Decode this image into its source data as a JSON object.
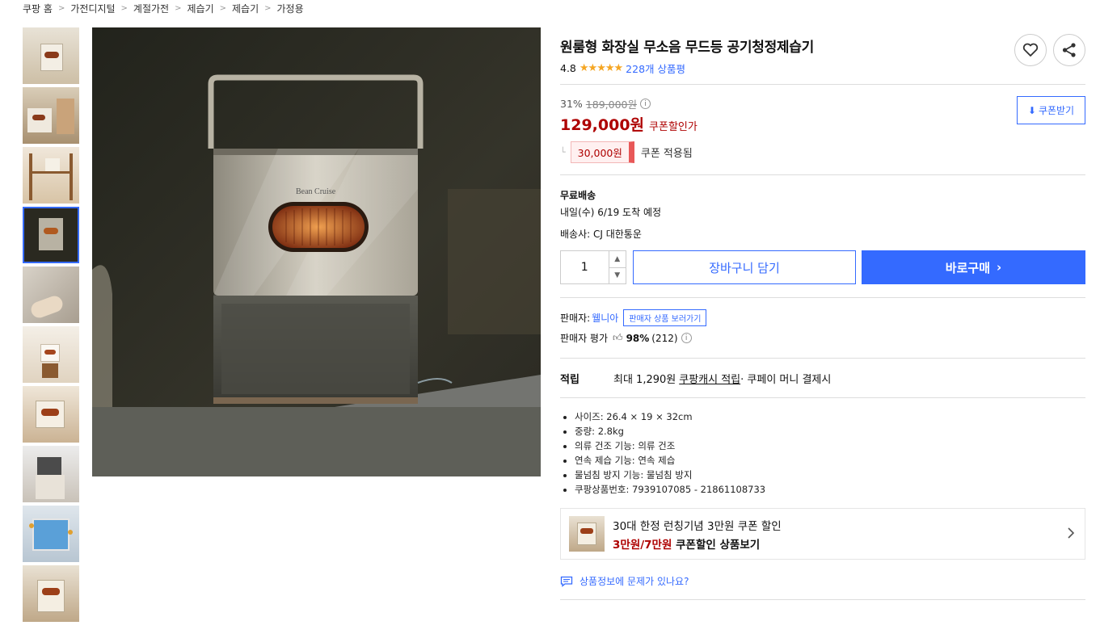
{
  "breadcrumb": [
    "쿠팡 홈",
    "가전디지털",
    "계절가전",
    "제습기",
    "제습기",
    "가정용"
  ],
  "product": {
    "title": "원룸형 화장실 무소음 무드등 공기청정제습기",
    "rating": "4.8",
    "stars": "★★★★★",
    "review_count": "228개 상품평"
  },
  "price": {
    "discount_rate": "31%",
    "original": "189,000원",
    "sale": "129,000원",
    "sale_label": "쿠폰할인가",
    "coupon_amount": "30,000원",
    "coupon_applied": "쿠폰 적용됨",
    "coupon_button": "쿠폰받기"
  },
  "shipping": {
    "label": "무료배송",
    "arrival": "내일(수) 6/19 도착 예정",
    "carrier": "배송사: CJ 대한통운"
  },
  "purchase": {
    "quantity": "1",
    "cart_label": "장바구니 담기",
    "buy_label": "바로구매"
  },
  "seller": {
    "label": "판매자:",
    "name": "웰니아",
    "link": "판매자 상품 보러가기",
    "rating_label": "판매자 평가",
    "score": "98%",
    "count": "(212)"
  },
  "points": {
    "label": "적립",
    "prefix": "최대 1,290원",
    "link": "쿠팡캐시 적립",
    "suffix": " · 쿠페이 머니 결제시"
  },
  "specs": [
    "사이즈: 26.4 × 19 × 32cm",
    "중량: 2.8kg",
    "의류 건조 기능: 의류 건조",
    "연속 제습 기능: 연속 제습",
    "물넘침 방지 기능: 물넘침 방지",
    "쿠팡상품번호: 7939107085 - 21861108733"
  ],
  "promo": {
    "title": "30대 한정 런칭기념 3만원 쿠폰 할인",
    "highlight": "3만원/7만원",
    "sub": " 쿠폰할인 상품보기"
  },
  "report": "상품정보에 문제가 있나요?",
  "colors": {
    "accent": "#346aff",
    "price_red": "#ae0000",
    "star": "#f5a623"
  }
}
